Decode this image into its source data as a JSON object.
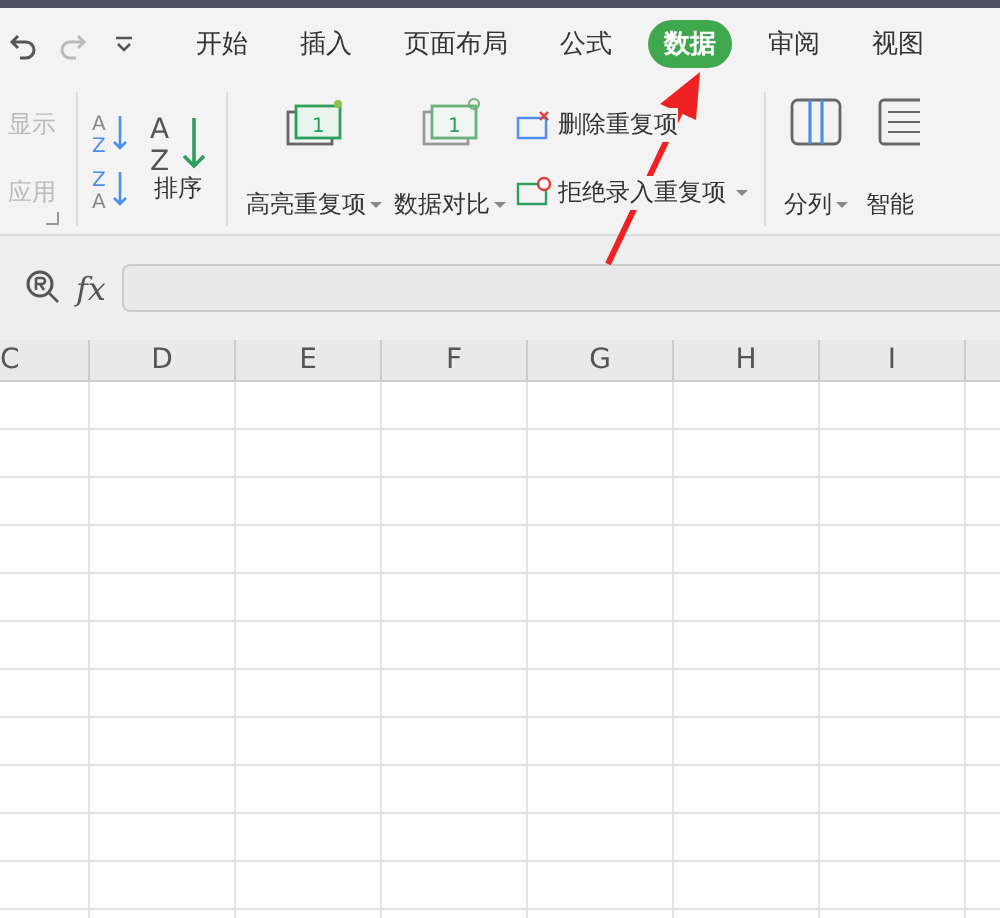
{
  "menu_tabs": [
    {
      "label": "开始",
      "selected": false
    },
    {
      "label": "插入",
      "selected": false
    },
    {
      "label": "页面布局",
      "selected": false
    },
    {
      "label": "公式",
      "selected": false
    },
    {
      "label": "数据",
      "selected": true
    },
    {
      "label": "审阅",
      "selected": false
    },
    {
      "label": "视图",
      "selected": false
    }
  ],
  "ribbon": {
    "partial_group": [
      {
        "label": "显示",
        "disabled": true
      },
      {
        "label": "应用",
        "disabled": true
      }
    ],
    "sort_small": [
      {
        "letters": [
          "A",
          "Z"
        ]
      },
      {
        "letters": [
          "Z",
          "A"
        ]
      }
    ],
    "sort_big_letters": [
      "A",
      "Z"
    ],
    "sort_label": "排序",
    "big_buttons": [
      {
        "label": "高亮重复项",
        "kind": "highlight",
        "icon_text": "1"
      },
      {
        "label": "数据对比",
        "kind": "compare",
        "icon_text": "1"
      }
    ],
    "small_buttons": [
      {
        "label": "删除重复项",
        "kind": "delete",
        "dropdown": false
      },
      {
        "label": "拒绝录入重复项",
        "kind": "reject",
        "dropdown": true
      }
    ],
    "split_label": "分列",
    "cut_label": "智能"
  },
  "formula_bar": {
    "fx": "fx"
  },
  "columns": [
    "C",
    "D",
    "E",
    "F",
    "G",
    "H",
    "I"
  ]
}
